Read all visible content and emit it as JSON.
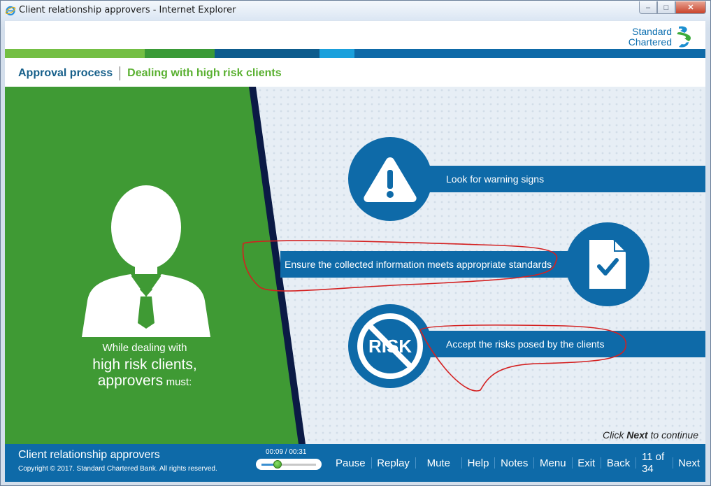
{
  "window": {
    "title": "Client relationship approvers - Internet Explorer",
    "buttons": {
      "minimize": "–",
      "maximize": "□",
      "close": "✕"
    }
  },
  "logo": {
    "line1": "Standard",
    "line2": "Chartered"
  },
  "colorbar": [
    "#74bf44",
    "#3a9a37",
    "#0d5c8d",
    "#1aa0dc",
    "#0e6aa8"
  ],
  "breadcrumb": {
    "section": "Approval process",
    "page": "Dealing with high risk clients"
  },
  "intro": {
    "line1": "While dealing with",
    "line2": "high risk clients,",
    "line3_big": "approvers",
    "line3_small": "must:"
  },
  "items": [
    {
      "icon": "warning-icon",
      "text": "Look for warning signs"
    },
    {
      "icon": "document-check-icon",
      "text": "Ensure the collected information meets appropriate standards"
    },
    {
      "icon": "no-risk-icon",
      "icon_text": "RISK",
      "text": "Accept the risks posed by the clients"
    }
  ],
  "prompt": {
    "prefix": "Click",
    "bold": "Next",
    "suffix": "to continue"
  },
  "footer": {
    "course_title": "Client relationship approvers",
    "copyright": "Copyright © 2017. Standard Chartered Bank. All rights reserved.",
    "time": "00:09 / 00:31",
    "progress": 0.29,
    "nav": {
      "pause": "Pause",
      "replay": "Replay",
      "mute": "Mute",
      "help": "Help",
      "notes": "Notes",
      "menu": "Menu",
      "exit": "Exit",
      "back": "Back",
      "page_counter": "11 of 34",
      "next": "Next"
    }
  },
  "colors": {
    "brand_blue": "#0e6aa8",
    "brand_green": "#3f9a34",
    "annotation_red": "#d42020"
  }
}
